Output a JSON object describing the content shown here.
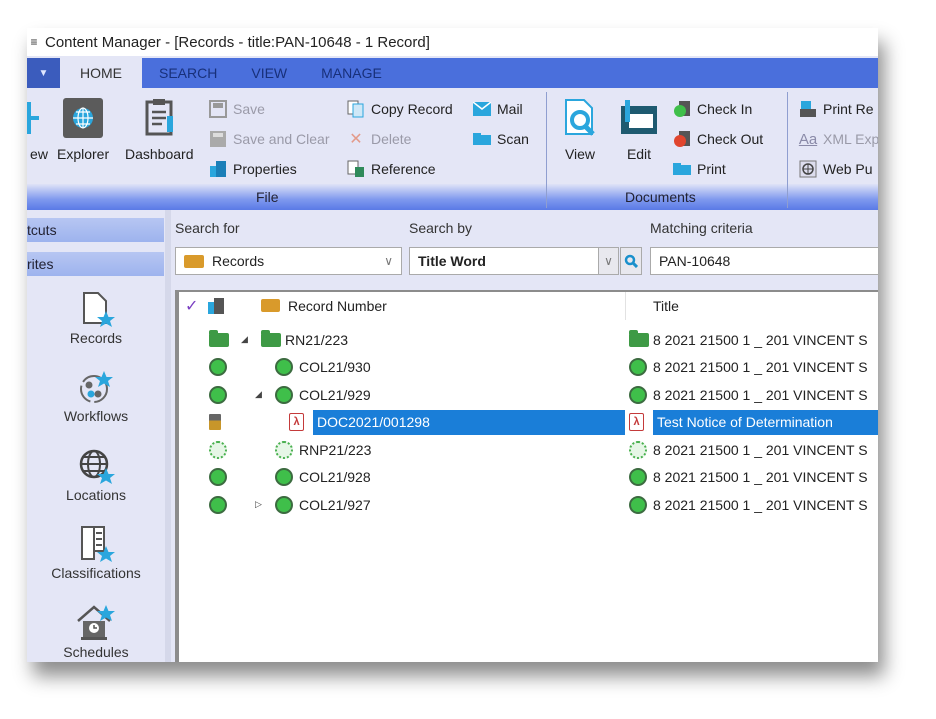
{
  "window": {
    "title": "Content Manager - [Records - title:PAN-10648 - 1 Record]",
    "quick_access_icon": "menu-icon"
  },
  "tabs": [
    {
      "label": "HOME",
      "active": true
    },
    {
      "label": "SEARCH",
      "active": false
    },
    {
      "label": "VIEW",
      "active": false
    },
    {
      "label": "MANAGE",
      "active": false
    }
  ],
  "ribbon": {
    "file_group": {
      "label": "File",
      "new_label": "ew",
      "explorer_label": "Explorer",
      "dashboard_label": "Dashboard",
      "save_label": "Save",
      "save_and_clear_label": "Save and Clear",
      "properties_label": "Properties",
      "copy_record_label": "Copy Record",
      "delete_label": "Delete",
      "reference_label": "Reference",
      "mail_label": "Mail",
      "scan_label": "Scan"
    },
    "documents_group": {
      "label": "Documents",
      "view_label": "View",
      "edit_label": "Edit",
      "check_in_label": "Check In",
      "check_out_label": "Check Out",
      "print_label": "Print"
    },
    "output_group": {
      "print_report_label": "Print Re",
      "xml_export_label": "XML Exp",
      "web_publish_label": "Web Pu"
    }
  },
  "sidebar": {
    "shortcuts_header": "tcuts",
    "favorites_header": "rites",
    "items": [
      {
        "label": "Records",
        "icon": "records-star-icon"
      },
      {
        "label": "Workflows",
        "icon": "workflows-star-icon"
      },
      {
        "label": "Locations",
        "icon": "locations-star-icon"
      },
      {
        "label": "Classifications",
        "icon": "classifications-star-icon"
      },
      {
        "label": "Schedules",
        "icon": "schedules-star-icon"
      }
    ]
  },
  "search": {
    "search_for_label": "Search for",
    "search_for_value": "Records",
    "search_by_label": "Search by",
    "search_by_value": "Title Word",
    "matching_label": "Matching criteria",
    "matching_value": "PAN-10648"
  },
  "grid": {
    "columns": [
      "Record Number",
      "Title"
    ],
    "rows": [
      {
        "number": "RN21/223",
        "title": "8 2021 21500 1 _ 201 VINCENT S",
        "icon": "folder",
        "expander": "expanded",
        "level": 0,
        "selected": false
      },
      {
        "number": "COL21/930",
        "title": "8 2021 21500 1 _ 201 VINCENT S",
        "icon": "dot",
        "expander": "none",
        "level": 1,
        "selected": false
      },
      {
        "number": "COL21/929",
        "title": "8 2021 21500 1 _ 201 VINCENT S",
        "icon": "dot",
        "expander": "expanded",
        "level": 1,
        "selected": false
      },
      {
        "number": "DOC2021/001298",
        "title": "Test Notice of Determination",
        "icon": "pdf",
        "expander": "none",
        "level": 2,
        "selected": true
      },
      {
        "number": "RNP21/223",
        "title": "8 2021 21500 1 _ 201 VINCENT S",
        "icon": "web",
        "expander": "none",
        "level": 1,
        "selected": false
      },
      {
        "number": "COL21/928",
        "title": "8 2021 21500 1 _ 201 VINCENT S",
        "icon": "dot",
        "expander": "none",
        "level": 1,
        "selected": false
      },
      {
        "number": "COL21/927",
        "title": "8 2021 21500 1 _ 201 VINCENT S",
        "icon": "dot",
        "expander": "collapsed",
        "level": 1,
        "selected": false
      }
    ]
  },
  "colors": {
    "ribbon_tab_bar": "#4a6fdc",
    "selection": "#1a7ed8",
    "status_green": "#3fbf4a",
    "pdf_red": "#c43a3a",
    "star_blue": "#2aa6dd"
  }
}
